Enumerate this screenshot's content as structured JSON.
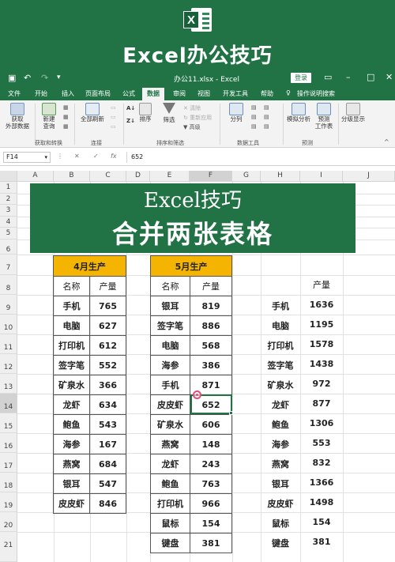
{
  "banner": {
    "title": "Excel办公技巧",
    "logo_letter": "X",
    "icon": "excel-logo-icon"
  },
  "titlebar": {
    "doc_title": "办公11.xlsx - Excel",
    "login": "登录",
    "save_icon": "save-icon",
    "undo_icon": "undo-icon",
    "redo_icon": "redo-icon"
  },
  "tabs": {
    "items": [
      "文件",
      "开始",
      "插入",
      "页面布局",
      "公式",
      "数据",
      "审阅",
      "视图",
      "开发工具",
      "帮助",
      "操作说明搜索"
    ],
    "active": "数据"
  },
  "ribbon": {
    "get_data": "获取\n外部数据",
    "new_query": "新建\n查询",
    "refresh_all": "全部刷新",
    "sort": "排序",
    "filter": "筛选",
    "clear": "清除",
    "reapply": "重新应用",
    "advanced": "高级",
    "split": "分列",
    "whatif": "模拟分析",
    "forecast": "预测\n工作表",
    "outline": "分级显示",
    "groups": [
      "获取和转换",
      "连接",
      "排序和筛选",
      "数据工具",
      "预测"
    ]
  },
  "formula_bar": {
    "name_box": "F14",
    "fx": "fx",
    "value": "652"
  },
  "columns": [
    "A",
    "B",
    "C",
    "D",
    "E",
    "F",
    "G",
    "H",
    "I",
    "J"
  ],
  "selected_column": "F",
  "rows": [
    "1",
    "2",
    "3",
    "4",
    "5",
    "6",
    "7",
    "8",
    "9",
    "10",
    "11",
    "12",
    "13",
    "14",
    "15",
    "16",
    "17",
    "18",
    "19",
    "20",
    "21"
  ],
  "selected_row": "14",
  "sheet_title": {
    "line1": "Excel技巧",
    "line2": "合并两张表格"
  },
  "table_april": {
    "header": "4月生产",
    "col_name": "名称",
    "col_qty": "产量",
    "rows": [
      [
        "手机",
        "765"
      ],
      [
        "电脑",
        "627"
      ],
      [
        "打印机",
        "612"
      ],
      [
        "签字笔",
        "552"
      ],
      [
        "矿泉水",
        "366"
      ],
      [
        "龙虾",
        "634"
      ],
      [
        "鲍鱼",
        "543"
      ],
      [
        "海参",
        "167"
      ],
      [
        "燕窝",
        "684"
      ],
      [
        "银耳",
        "547"
      ],
      [
        "皮皮虾",
        "846"
      ]
    ]
  },
  "table_may": {
    "header": "5月生产",
    "col_name": "名称",
    "col_qty": "产量",
    "rows": [
      [
        "银耳",
        "819"
      ],
      [
        "签字笔",
        "886"
      ],
      [
        "电脑",
        "568"
      ],
      [
        "海参",
        "386"
      ],
      [
        "手机",
        "871"
      ],
      [
        "皮皮虾",
        "652"
      ],
      [
        "矿泉水",
        "606"
      ],
      [
        "燕窝",
        "148"
      ],
      [
        "龙虾",
        "243"
      ],
      [
        "鲍鱼",
        "763"
      ],
      [
        "打印机",
        "966"
      ],
      [
        "鼠标",
        "154"
      ],
      [
        "键盘",
        "381"
      ]
    ]
  },
  "merged": {
    "col_qty": "产量",
    "rows": [
      [
        "手机",
        "1636"
      ],
      [
        "电脑",
        "1195"
      ],
      [
        "打印机",
        "1578"
      ],
      [
        "签字笔",
        "1438"
      ],
      [
        "矿泉水",
        "972"
      ],
      [
        "龙虾",
        "877"
      ],
      [
        "鲍鱼",
        "1306"
      ],
      [
        "海参",
        "553"
      ],
      [
        "燕窝",
        "832"
      ],
      [
        "银耳",
        "1366"
      ],
      [
        "皮皮虾",
        "1498"
      ],
      [
        "鼠标",
        "154"
      ],
      [
        "键盘",
        "381"
      ]
    ]
  },
  "colors": {
    "excel_green": "#217346",
    "header_fill": "#F5B400"
  }
}
